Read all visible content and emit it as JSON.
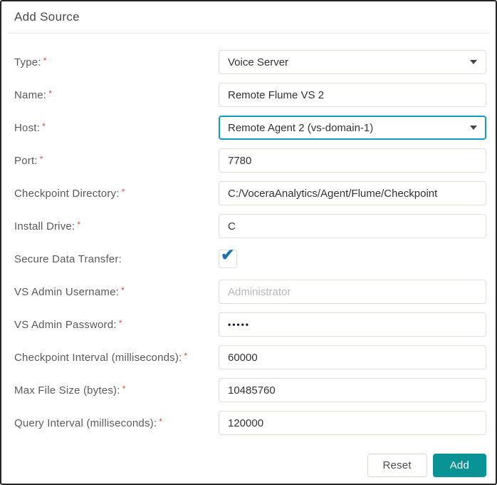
{
  "page": {
    "title": "Add Source"
  },
  "required_marker": "*",
  "icons": {
    "chevron_down": "triangle-down",
    "check": "✔"
  },
  "colors": {
    "accent_teal": "#0a9394",
    "focus_border": "#1697c2",
    "check_blue": "#1b76b3",
    "required_red": "#e04b3a",
    "field_border": "#e2ded8",
    "label_gray": "#5b5b5b"
  },
  "form": {
    "fields": [
      {
        "id": "type",
        "label": "Type:",
        "required": true,
        "type": "select",
        "value": "Voice Server"
      },
      {
        "id": "name",
        "label": "Name:",
        "required": true,
        "type": "text",
        "value": "Remote Flume VS 2"
      },
      {
        "id": "host",
        "label": "Host:",
        "required": true,
        "type": "select",
        "value": "Remote Agent 2 (vs-domain-1)",
        "focused": true
      },
      {
        "id": "port",
        "label": "Port:",
        "required": true,
        "type": "text",
        "value": "7780"
      },
      {
        "id": "checkpoint-directory",
        "label": "Checkpoint Directory:",
        "required": true,
        "type": "text",
        "value": "C:/VoceraAnalytics/Agent/Flume/Checkpoint"
      },
      {
        "id": "install-drive",
        "label": "Install Drive:",
        "required": true,
        "type": "text",
        "value": "C"
      },
      {
        "id": "secure-data-transfer",
        "label": "Secure Data Transfer:",
        "required": false,
        "type": "checkbox",
        "checked": true
      },
      {
        "id": "vs-admin-username",
        "label": "VS Admin Username:",
        "required": true,
        "type": "text",
        "value": "",
        "placeholder": "Administrator"
      },
      {
        "id": "vs-admin-password",
        "label": "VS Admin Password:",
        "required": true,
        "type": "password",
        "value": "•••••"
      },
      {
        "id": "checkpoint-interval",
        "label": "Checkpoint Interval (milliseconds):",
        "required": true,
        "type": "text",
        "value": "60000"
      },
      {
        "id": "max-file-size",
        "label": "Max File Size (bytes):",
        "required": true,
        "type": "text",
        "value": "10485760"
      },
      {
        "id": "query-interval",
        "label": "Query Interval (milliseconds):",
        "required": true,
        "type": "text",
        "value": "120000"
      }
    ],
    "buttons": {
      "reset": "Reset",
      "add": "Add"
    }
  }
}
